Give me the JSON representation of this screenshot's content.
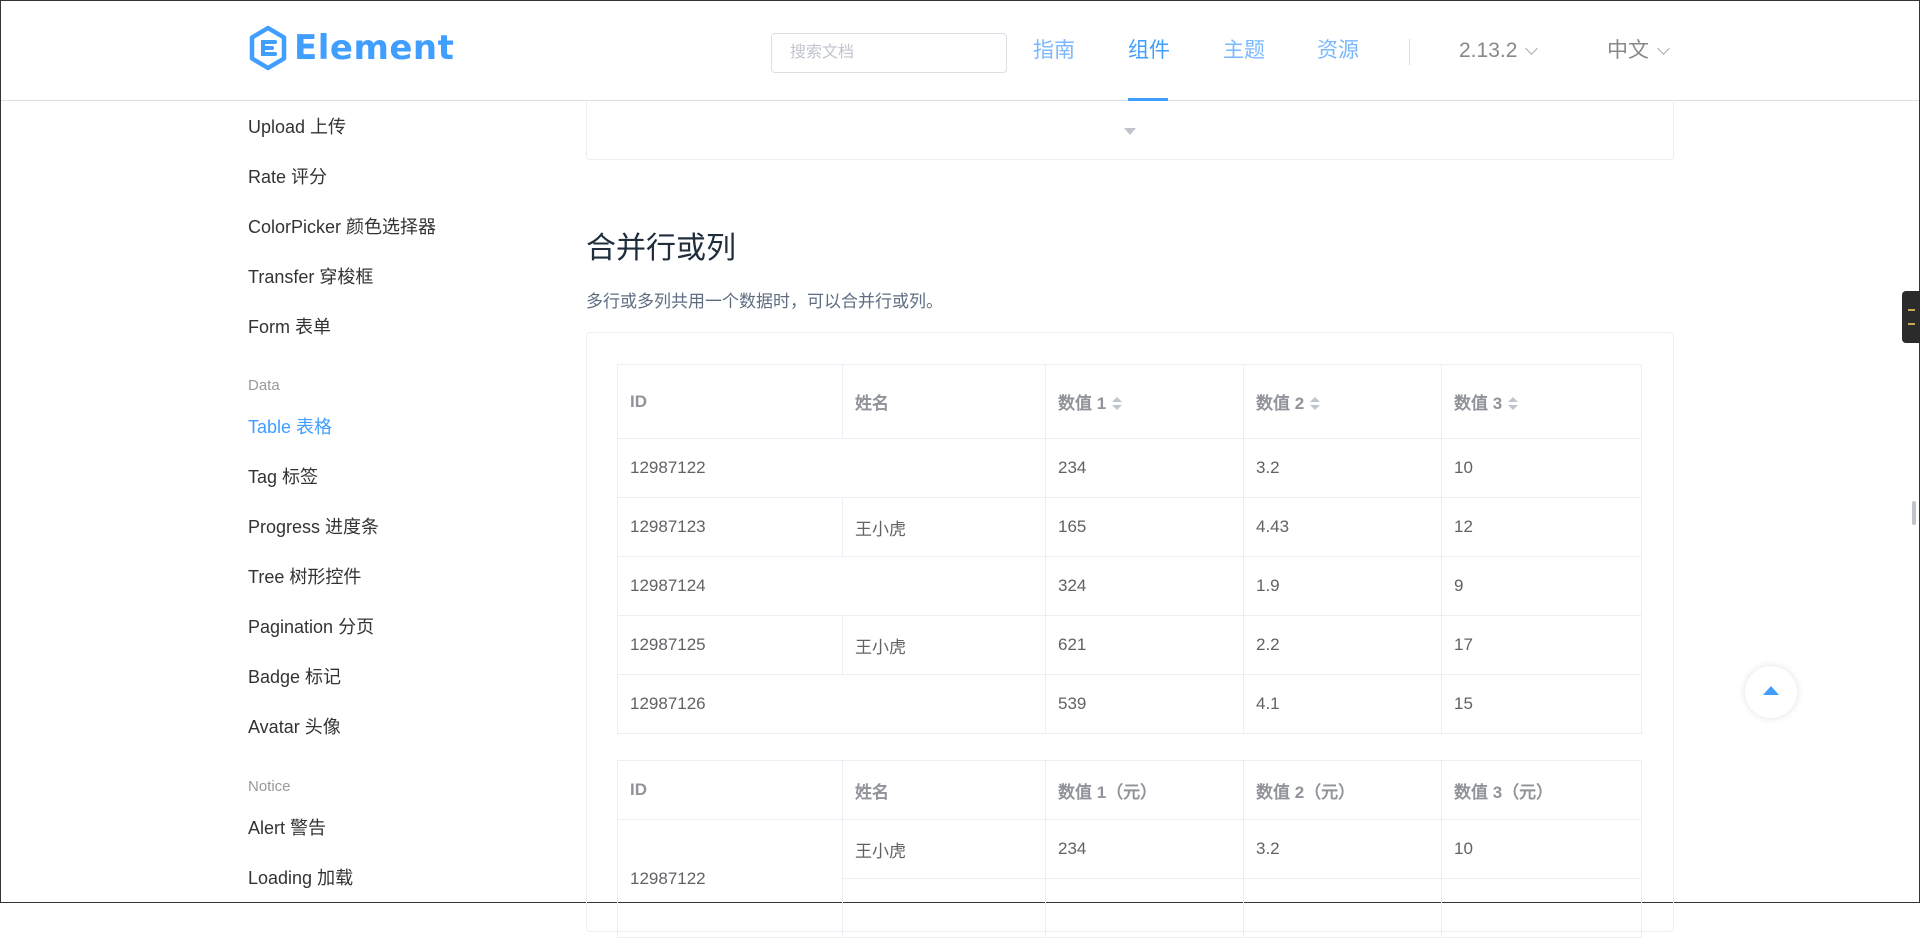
{
  "header": {
    "logo_text": "Element",
    "search_placeholder": "搜索文档",
    "nav": [
      {
        "label": "指南",
        "active": false
      },
      {
        "label": "组件",
        "active": true
      },
      {
        "label": "主题",
        "active": false
      },
      {
        "label": "资源",
        "active": false
      }
    ],
    "version": "2.13.2",
    "language": "中文"
  },
  "sidebar": {
    "items_top": [
      "Upload 上传",
      "Rate 评分",
      "ColorPicker 颜色选择器",
      "Transfer 穿梭框",
      "Form 表单"
    ],
    "group_data": "Data",
    "items_data": [
      "Table 表格",
      "Tag 标签",
      "Progress 进度条",
      "Tree 树形控件",
      "Pagination 分页",
      "Badge 标记",
      "Avatar 头像"
    ],
    "active_item": "Table 表格",
    "group_notice": "Notice",
    "items_notice": [
      "Alert 警告",
      "Loading 加载"
    ]
  },
  "section": {
    "title": "合并行或列",
    "description": "多行或多列共用一个数据时，可以合并行或列。"
  },
  "table1": {
    "headers": [
      "ID",
      "姓名",
      "数值 1",
      "数值 2",
      "数值 3"
    ],
    "rows": [
      [
        "12987122",
        "",
        "234",
        "3.2",
        "10"
      ],
      [
        "12987123",
        "王小虎",
        "165",
        "4.43",
        "12"
      ],
      [
        "12987124",
        "",
        "324",
        "1.9",
        "9"
      ],
      [
        "12987125",
        "王小虎",
        "621",
        "2.2",
        "17"
      ],
      [
        "12987126",
        "",
        "539",
        "4.1",
        "15"
      ]
    ]
  },
  "table2": {
    "headers": [
      "ID",
      "姓名",
      "数值 1（元）",
      "数值 2（元）",
      "数值 3（元）"
    ],
    "rows": [
      [
        "12987122",
        "王小虎",
        "234",
        "3.2",
        "10"
      ]
    ]
  }
}
